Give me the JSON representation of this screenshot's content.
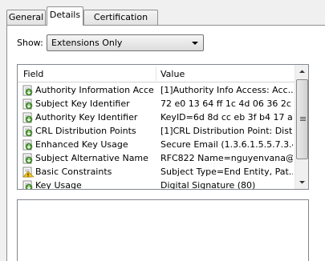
{
  "tabs": [
    {
      "label": "General"
    },
    {
      "label": "Details"
    },
    {
      "label": "Certification Path"
    }
  ],
  "show": {
    "label": "Show:",
    "selected": "Extensions Only"
  },
  "columns": {
    "field": "Field",
    "value": "Value"
  },
  "rows": [
    {
      "field": "Authority Information Access",
      "value": "[1]Authority Info Access: Acc...",
      "icon": "cert-extension-icon"
    },
    {
      "field": "Subject Key Identifier",
      "value": "72 e0 13 64 ff 1c 4d 06 36 2c ...",
      "icon": "cert-extension-icon"
    },
    {
      "field": "Authority Key Identifier",
      "value": "KeyID=6d 8d cc eb 3f b4 17 a...",
      "icon": "cert-extension-icon"
    },
    {
      "field": "CRL Distribution Points",
      "value": "[1]CRL Distribution Point: Distr...",
      "icon": "cert-extension-icon"
    },
    {
      "field": "Enhanced Key Usage",
      "value": "Secure Email (1.3.6.1.5.5.7.3.4)",
      "icon": "cert-extension-icon"
    },
    {
      "field": "Subject Alternative Name",
      "value": "RFC822 Name=nguyenvana@...",
      "icon": "cert-extension-icon"
    },
    {
      "field": "Basic Constraints",
      "value": "Subject Type=End Entity, Pat...",
      "icon": "critical-extension-icon"
    },
    {
      "field": "Key Usage",
      "value": "Digital Signature (80)",
      "icon": "cert-extension-icon"
    }
  ],
  "colors": {
    "accent": "#3c7fb1",
    "icon_green": "#4e9a34",
    "icon_yellow": "#f0c419"
  }
}
